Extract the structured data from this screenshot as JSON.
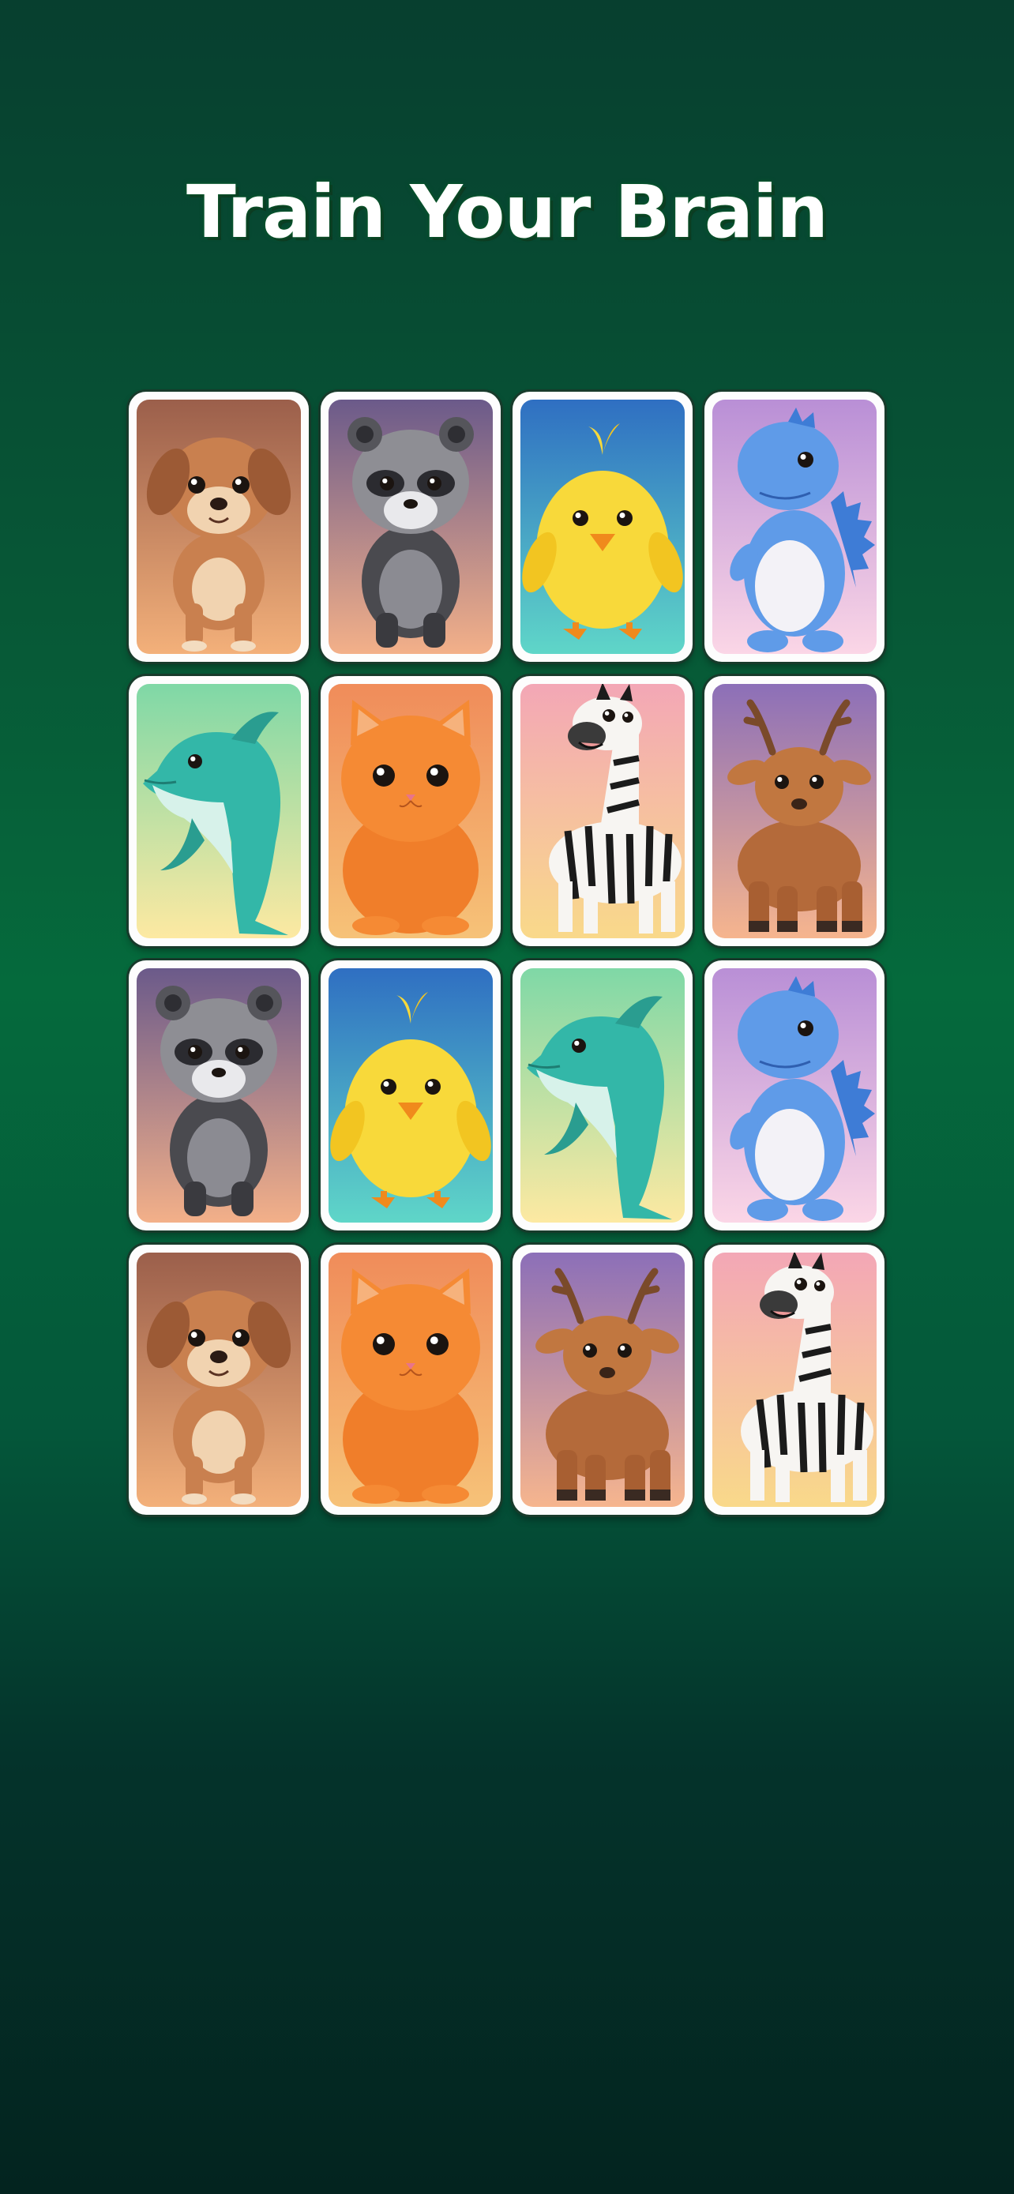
{
  "title": "Train Your Brain",
  "cards": [
    {
      "animal": "puppy",
      "icon": "puppy-icon",
      "bg": [
        "#9b5f4b",
        "#f3b07a"
      ]
    },
    {
      "animal": "raccoon",
      "icon": "raccoon-icon",
      "bg": [
        "#6b5a8a",
        "#f3b089"
      ]
    },
    {
      "animal": "chick",
      "icon": "chick-icon",
      "bg": [
        "#2f6fc2",
        "#5fd6c8"
      ]
    },
    {
      "animal": "dinosaur",
      "icon": "dinosaur-icon",
      "bg": [
        "#b98fd6",
        "#fbd6e6"
      ]
    },
    {
      "animal": "dolphin",
      "icon": "dolphin-icon",
      "bg": [
        "#7fd8a6",
        "#fde9a2"
      ]
    },
    {
      "animal": "kitten",
      "icon": "kitten-icon",
      "bg": [
        "#f08c5a",
        "#f6c278"
      ]
    },
    {
      "animal": "zebra",
      "icon": "zebra-icon",
      "bg": [
        "#f3a7b6",
        "#f9d98a"
      ]
    },
    {
      "animal": "deer",
      "icon": "deer-icon",
      "bg": [
        "#8c6fb8",
        "#f6b58e"
      ]
    },
    {
      "animal": "raccoon",
      "icon": "raccoon-icon",
      "bg": [
        "#6b5a8a",
        "#f3b089"
      ]
    },
    {
      "animal": "chick",
      "icon": "chick-icon",
      "bg": [
        "#2f6fc2",
        "#5fd6c8"
      ]
    },
    {
      "animal": "dolphin",
      "icon": "dolphin-icon",
      "bg": [
        "#7fd8a6",
        "#fde9a2"
      ]
    },
    {
      "animal": "dinosaur",
      "icon": "dinosaur-icon",
      "bg": [
        "#b98fd6",
        "#fbd6e6"
      ]
    },
    {
      "animal": "puppy",
      "icon": "puppy-icon",
      "bg": [
        "#9b5f4b",
        "#f3b07a"
      ]
    },
    {
      "animal": "kitten",
      "icon": "kitten-icon",
      "bg": [
        "#f08c5a",
        "#f6c278"
      ]
    },
    {
      "animal": "deer",
      "icon": "deer-icon",
      "bg": [
        "#8c6fb8",
        "#f6b58e"
      ]
    },
    {
      "animal": "zebra",
      "icon": "zebra-icon",
      "bg": [
        "#f3a7b6",
        "#f9d98a"
      ]
    }
  ]
}
